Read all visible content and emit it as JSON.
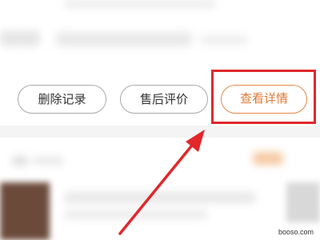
{
  "actions": {
    "delete_label": "删除记录",
    "review_label": "售后评价",
    "detail_label": "查看详情"
  },
  "watermark": {
    "text": "booso.com"
  },
  "colors": {
    "highlight": "#e0282c",
    "accent": "#e07a36",
    "arrow": "#e0282c"
  }
}
